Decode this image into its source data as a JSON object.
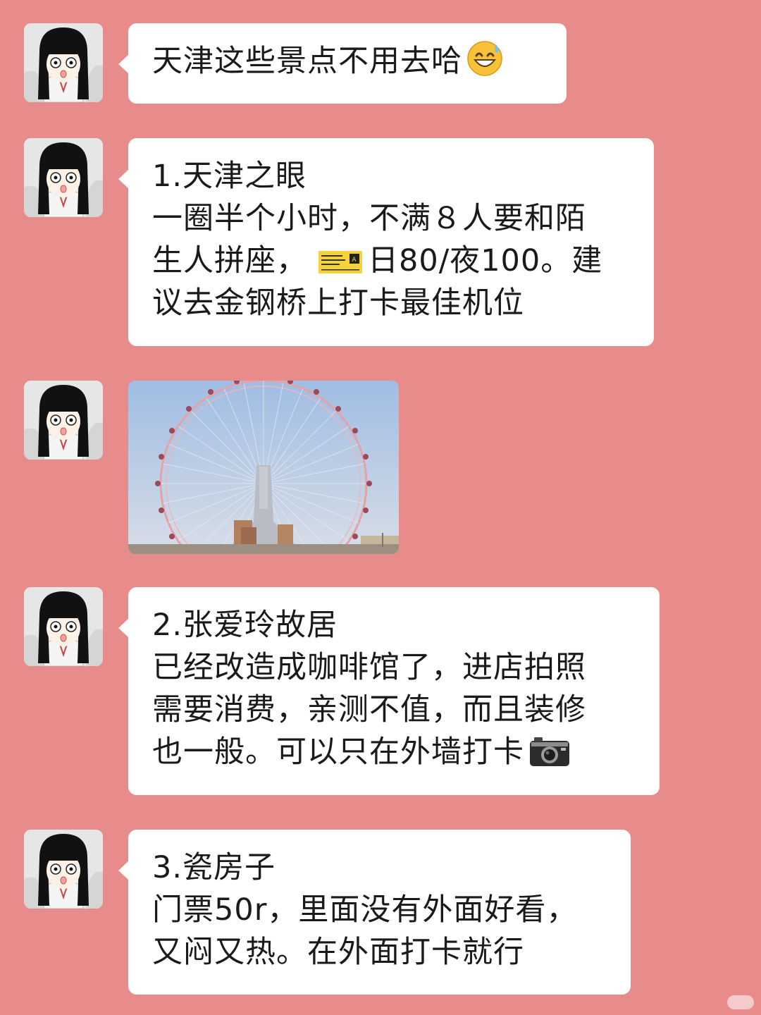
{
  "chat": {
    "messages": [
      {
        "lines": [
          "天津这些景点不用去哈"
        ],
        "emoji": "grinning-sweat-emoji"
      },
      {
        "lines": [
          "1.天津之眼",
          "一圈半个小时，不满８人要和陌",
          "日80/夜100。建",
          "议去金钢桥上打卡最佳机位"
        ],
        "line3_prefix": "生人拼座，",
        "ticket_icon": "concert-ticket-icon"
      },
      {
        "image": "ferris-wheel-photo"
      },
      {
        "lines": [
          "2.张爱玲故居",
          "已经改造成咖啡馆了，进店拍照",
          "需要消费，亲测不值，而且装修",
          "也一般。可以只在外墙打卡"
        ],
        "emoji": "camera-icon"
      },
      {
        "lines": [
          "3.瓷房子",
          "门票50r，里面没有外面好看，",
          "又闷又热。在外面打卡就行"
        ]
      }
    ]
  },
  "colors": {
    "background": "#e88b8b",
    "bubble": "#ffffff",
    "text": "#1a1a1a"
  }
}
